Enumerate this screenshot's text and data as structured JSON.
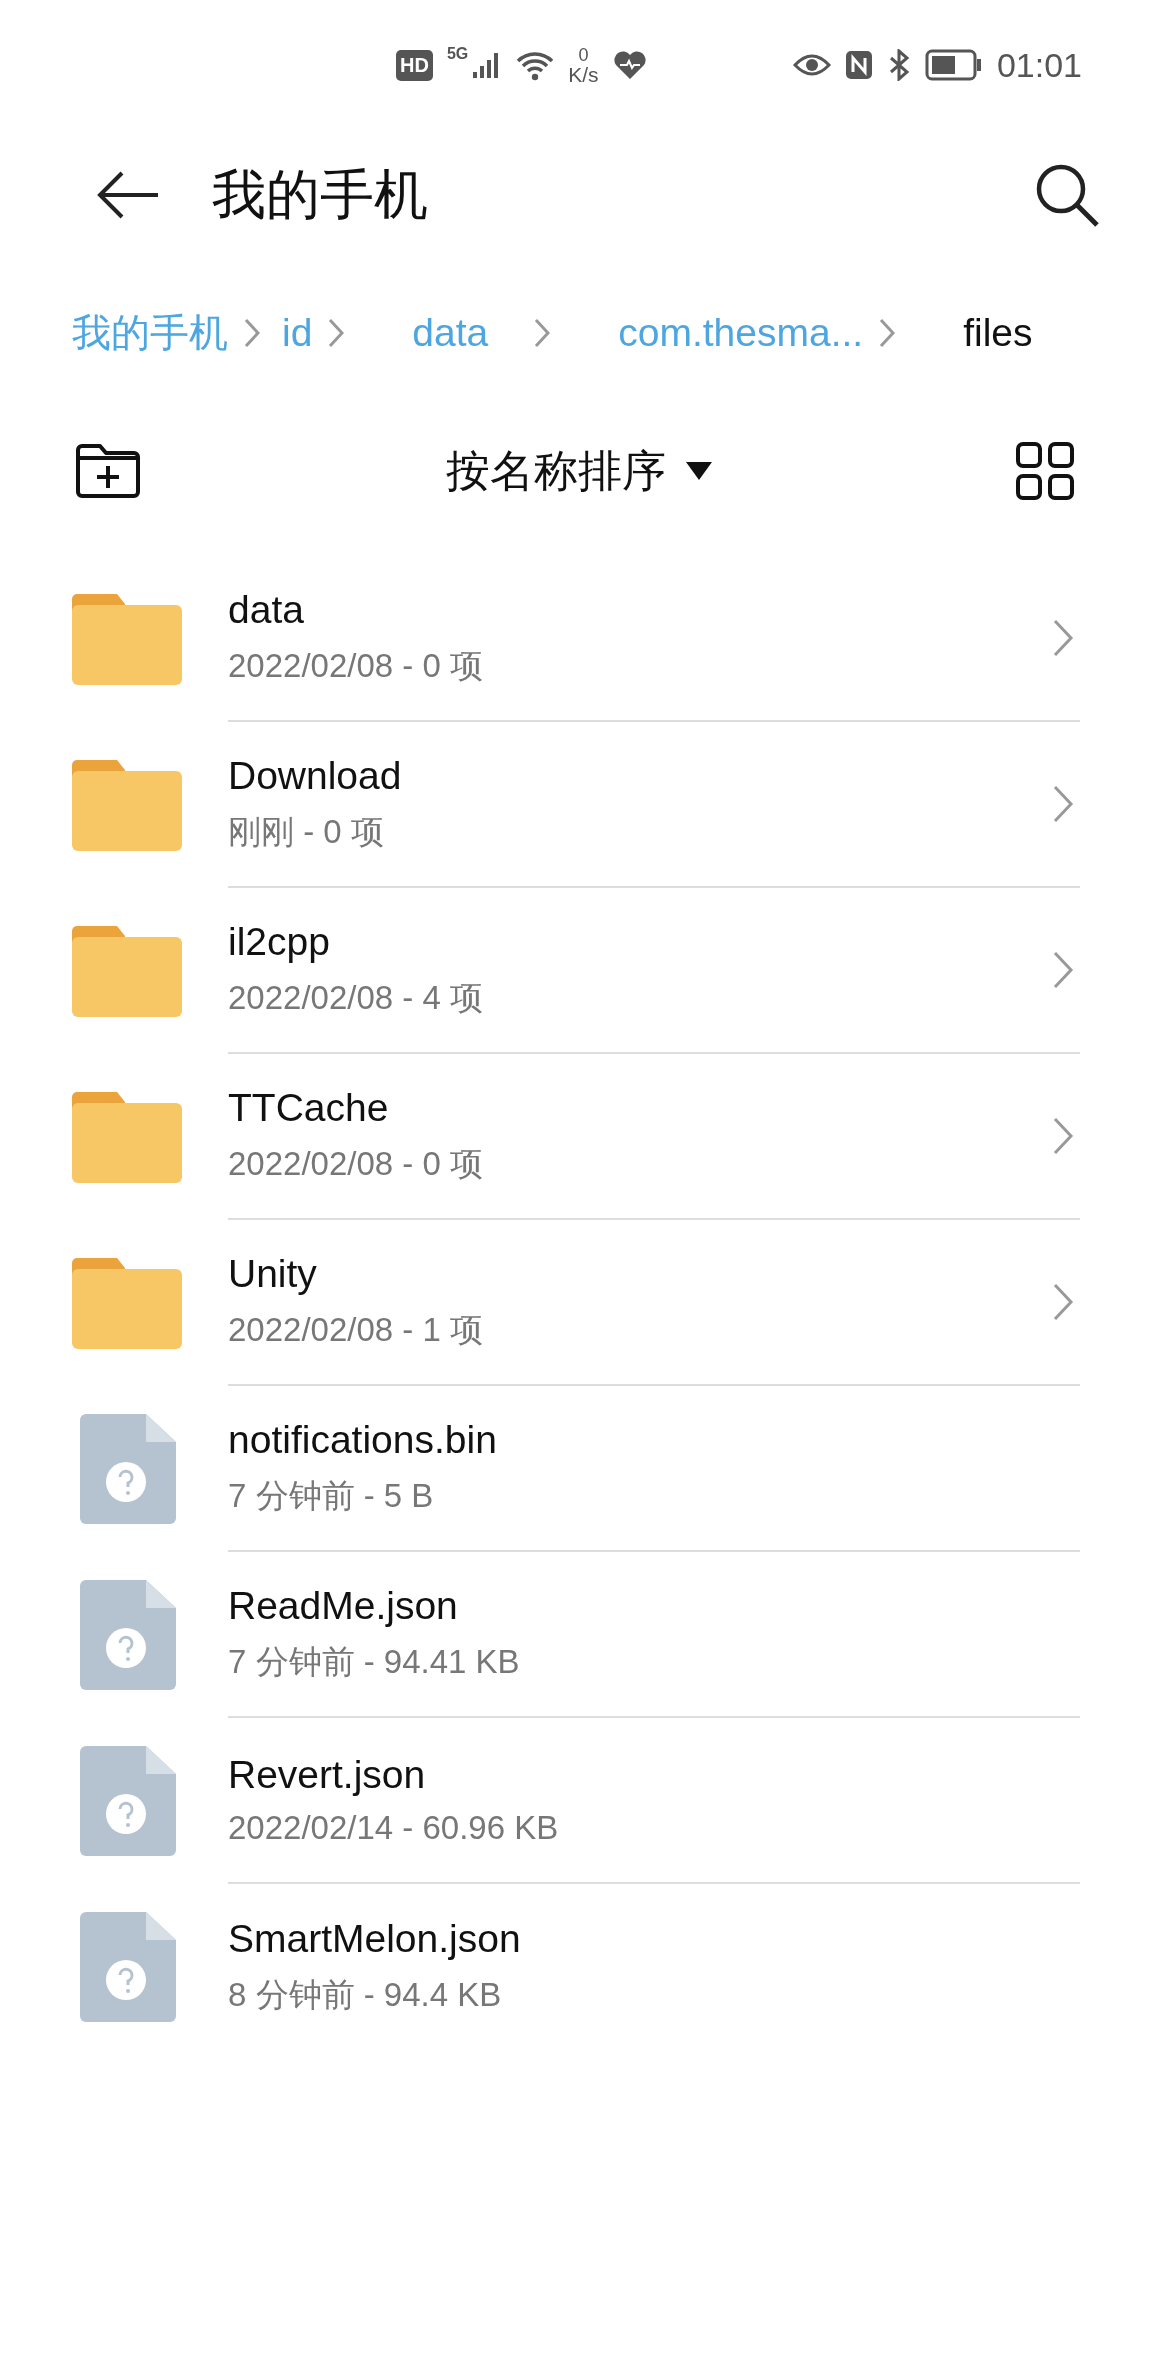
{
  "status_bar": {
    "hd": "HD",
    "network": "5G",
    "speed_value": "0",
    "speed_unit": "K/s",
    "time": "01:01"
  },
  "header": {
    "title": "我的手机"
  },
  "breadcrumb": [
    {
      "label": "我的手机",
      "selected": false
    },
    {
      "label": "id",
      "selected": false
    },
    {
      "label": "data",
      "selected": false
    },
    {
      "label": "com.thesma...",
      "selected": false
    },
    {
      "label": "files",
      "selected": true
    }
  ],
  "toolbar": {
    "sort_label": "按名称排序"
  },
  "items": [
    {
      "kind": "folder",
      "name": "data",
      "meta": "2022/02/08 - 0 项"
    },
    {
      "kind": "folder",
      "name": "Download",
      "meta": "刚刚 - 0 项"
    },
    {
      "kind": "folder",
      "name": "il2cpp",
      "meta": "2022/02/08 - 4 项"
    },
    {
      "kind": "folder",
      "name": "TTCache",
      "meta": "2022/02/08 - 0 项"
    },
    {
      "kind": "folder",
      "name": "Unity",
      "meta": "2022/02/08 - 1 项"
    },
    {
      "kind": "file",
      "name": "notifications.bin",
      "meta": "7 分钟前 - 5 B"
    },
    {
      "kind": "file",
      "name": "ReadMe.json",
      "meta": "7 分钟前 - 94.41 KB"
    },
    {
      "kind": "file",
      "name": "Revert.json",
      "meta": "2022/02/14 - 60.96 KB"
    },
    {
      "kind": "file",
      "name": "SmartMelon.json",
      "meta": "8 分钟前 - 94.4 KB"
    }
  ]
}
